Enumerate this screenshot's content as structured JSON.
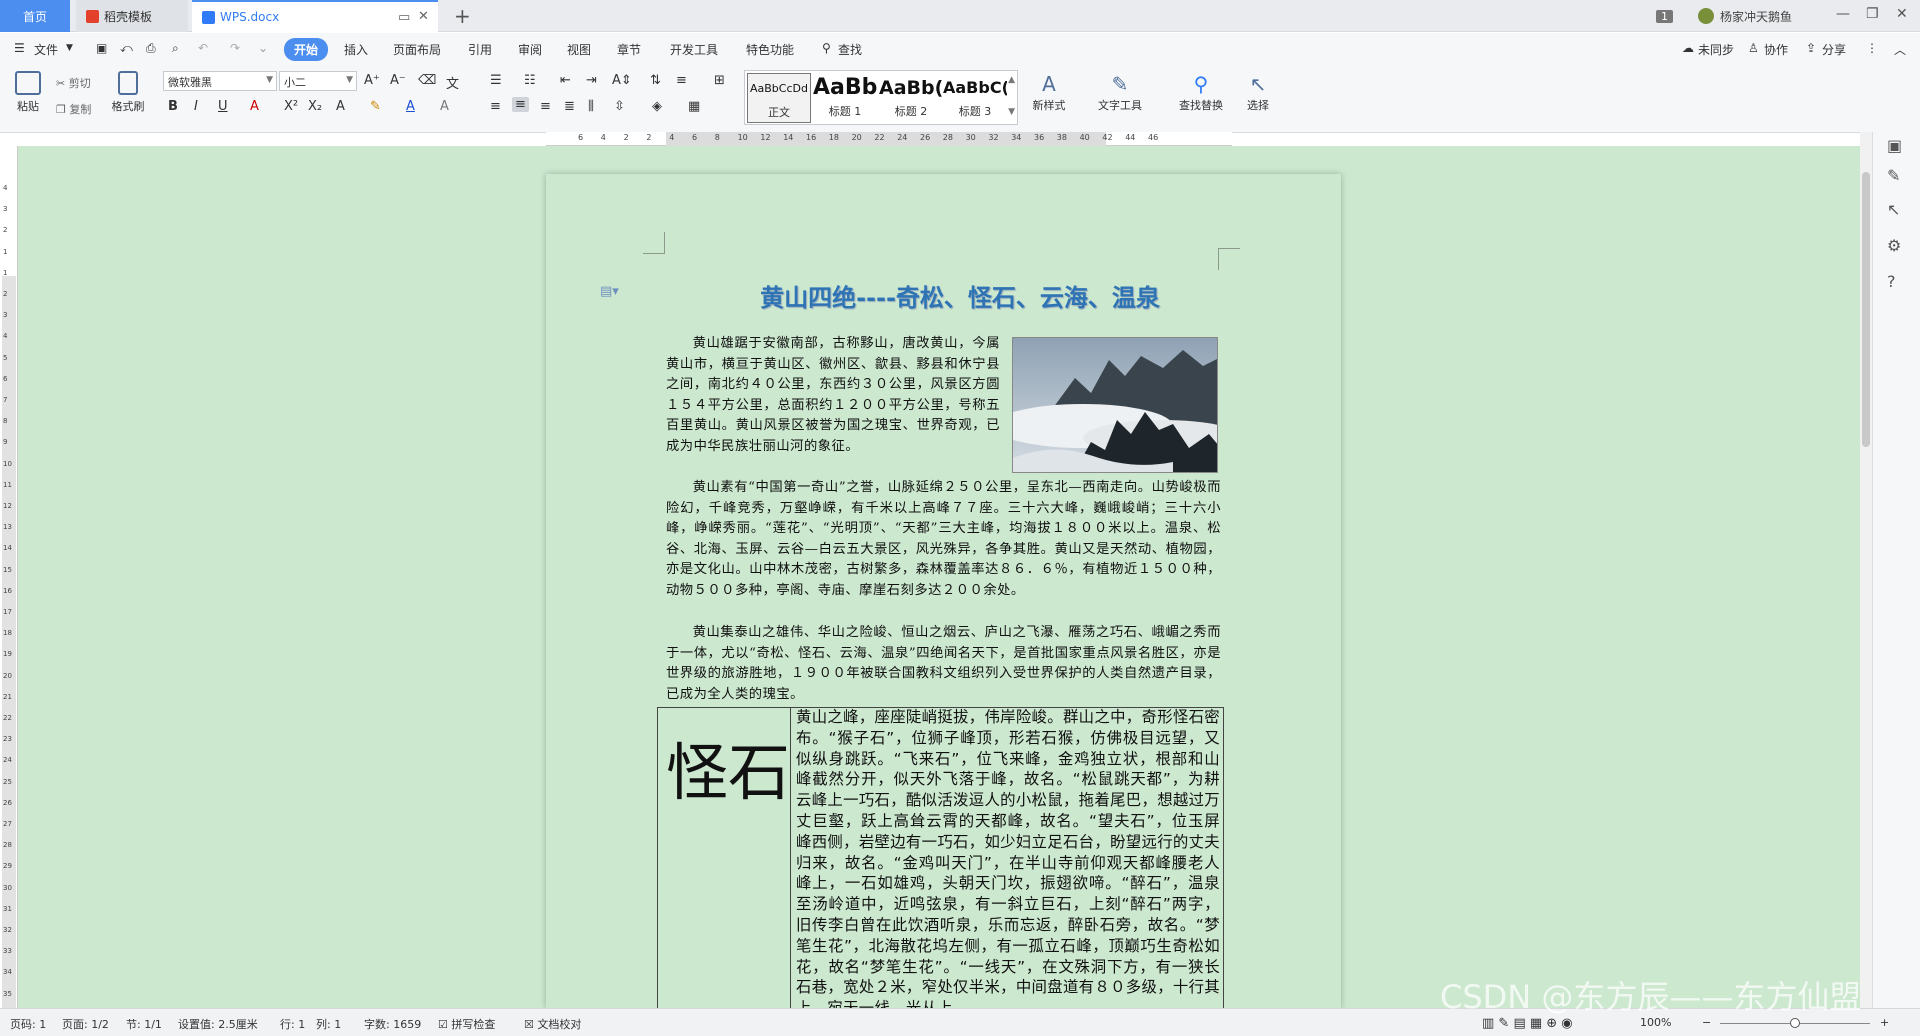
{
  "tabs": {
    "home": "首页",
    "templates": "稻壳模板",
    "document": "WPS.docx",
    "add": "+"
  },
  "titlebar": {
    "badge": "1",
    "user": "杨家冲天鹅鱼",
    "minimize": "—",
    "restore": "❐",
    "close": "✕"
  },
  "menu": {
    "file": "文件",
    "items": [
      "开始",
      "插入",
      "页面布局",
      "引用",
      "审阅",
      "视图",
      "章节",
      "开发工具",
      "特色功能"
    ],
    "search": "查找",
    "sync": "未同步",
    "collab": "协作",
    "share": "分享"
  },
  "ribbon": {
    "paste": "粘贴",
    "cut": "剪切",
    "copy": "复制",
    "format_painter": "格式刷",
    "font_name": "微软雅黑",
    "font_size": "小二",
    "styles": [
      {
        "sample": "AaBbCcDd",
        "name": "正文"
      },
      {
        "sample": "AaBb",
        "name": "标题 1"
      },
      {
        "sample": "AaBb(",
        "name": "标题 2"
      },
      {
        "sample": "AaBbC(",
        "name": "标题 3"
      }
    ],
    "new_style": "新样式",
    "text_tools": "文字工具",
    "find_replace": "查找替换",
    "select": "选择"
  },
  "ruler": {
    "h": [
      "6",
      "4",
      "2",
      "2",
      "4",
      "6",
      "8",
      "10",
      "12",
      "14",
      "16",
      "18",
      "20",
      "22",
      "24",
      "26",
      "28",
      "30",
      "32",
      "34",
      "36",
      "38",
      "40",
      "42",
      "44",
      "46"
    ],
    "v": [
      "4",
      "3",
      "2",
      "1",
      "1",
      "2",
      "3",
      "4",
      "5",
      "6",
      "7",
      "8",
      "9",
      "10",
      "11",
      "12",
      "13",
      "14",
      "15",
      "16",
      "17",
      "18",
      "19",
      "20",
      "21",
      "22",
      "23",
      "24",
      "25",
      "26",
      "27",
      "28",
      "29",
      "30",
      "31",
      "32",
      "33",
      "34",
      "35"
    ]
  },
  "document": {
    "title": "黄山四绝----奇松、怪石、云海、温泉",
    "para1": "黄山雄踞于安徽南部，古称黟山，唐改黄山，今属黄山市，横亘于黄山区、徽州区、歙县、黟县和休宁县之间，南北约４０公里，东西约３０公里，风景区方圆１５４平方公里，总面积约１２００平方公里，号称五百里黄山。黄山风景区被誉为国之瑰宝、世界奇观，已成为中华民族壮丽山河的象征。",
    "para2": "黄山素有“中国第一奇山”之誉，山脉延绵２５０公里，呈东北—西南走向。山势峻极而险幻，千峰竞秀，万壑峥嵘，有千米以上高峰７７座。三十六大峰，巍峨峻峭；三十六小峰，峥嵘秀丽。“莲花”、“光明顶”、“天都”三大主峰，均海拔１８００米以上。温泉、松谷、北海、玉屏、云谷—白云五大景区，风光殊异，各争其胜。黄山又是天然动、植物园，亦是文化山。山中林木茂密，古树繁多，森林覆盖率达８６．６％，有植物近１５００种，动物５００多种，亭阁、寺庙、摩崖石刻多达２００余处。",
    "para3": "黄山集泰山之雄伟、华山之险峻、恒山之烟云、庐山之飞瀑、雁荡之巧石、峨嵋之秀而于一体，尤以“奇松、怪石、云海、温泉”四绝闻名天下，是首批国家重点风景名胜区，亦是世界级的旅游胜地，１９００年被联合国教科文组织列入受世界保护的人类自然遗产目录，已成为全人类的瑰宝。",
    "cell_title": "怪石",
    "cell_text": "黄山之峰，座座陡峭挺拔，伟岸险峻。群山之中，奇形怪石密布。“猴子石”，位狮子峰顶，形若石猴，仿佛极目远望，又似纵身跳跃。“飞来石”，位飞来峰，金鸡独立状，根部和山峰截然分开，似天外飞落于峰，故名。“松鼠跳天都”，为耕云峰上一巧石，酷似活泼逗人的小松鼠，拖着尾巴，想越过万丈巨壑，跃上高耸云霄的天都峰，故名。“望夫石”，位玉屏峰西侧，岩壁边有一巧石，如少妇立足石台，盼望远行的丈夫归来，故名。“金鸡叫天门”，在半山寺前仰观天都峰腰老人峰上，一石如雄鸡，头朝天门坎，振翅欲啼。“醉石”，温泉至汤岭道中，近鸣弦泉，有一斜立巨石，上刻“醉石”两字，旧传李白曾在此饮酒听泉，乐而忘返，醉卧石旁，故名。“梦笔生花”，北海散花坞左侧，有一孤立石峰，顶巅巧生奇松如花，故名“梦笔生花”。“一线天”，在文殊洞下方，有一狭长石巷，宽处２米，窄处仅半米，中间盘道有８０多级，十行其上，宛天一线，光从上..."
  },
  "status": {
    "page_code": "页码: 1",
    "page": "页面: 1/2",
    "section": "节: 1/1",
    "setting": "设置值: 2.5厘米",
    "row": "行: 1",
    "col": "列: 1",
    "words": "字数: 1659",
    "spell": "拼写检查",
    "proof": "文档校对",
    "zoom": "100%",
    "watermark": "CSDN @东方辰——东方仙盟"
  },
  "colors": {
    "accent": "#4b8ef0",
    "title": "#2e74b5",
    "page_bg": "#cce8cf"
  }
}
